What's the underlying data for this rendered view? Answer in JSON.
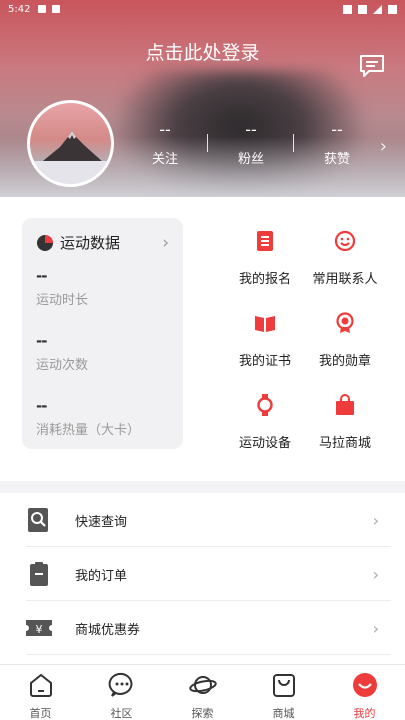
{
  "status_bar": {
    "time": "5:42"
  },
  "header": {
    "login_prompt": "点击此处登录",
    "message_icon": "message-icon",
    "stats": [
      {
        "value": "--",
        "label": "关注"
      },
      {
        "value": "--",
        "label": "粉丝"
      },
      {
        "value": "--",
        "label": "获赞"
      }
    ]
  },
  "sport_card": {
    "title": "运动数据",
    "metrics": [
      {
        "value": "--",
        "label": "运动时长"
      },
      {
        "value": "--",
        "label": "运动次数"
      },
      {
        "value": "--",
        "label": "消耗热量（大卡）"
      }
    ]
  },
  "grid": [
    {
      "label": "我的报名",
      "icon": "registration-icon"
    },
    {
      "label": "常用联系人",
      "icon": "contacts-icon"
    },
    {
      "label": "我的证书",
      "icon": "certificate-icon"
    },
    {
      "label": "我的勋章",
      "icon": "medal-icon"
    },
    {
      "label": "运动设备",
      "icon": "watch-icon"
    },
    {
      "label": "马拉商城",
      "icon": "shop-bag-icon"
    }
  ],
  "list": [
    {
      "label": "快速查询",
      "icon": "quick-search-icon"
    },
    {
      "label": "我的订单",
      "icon": "order-icon"
    },
    {
      "label": "商城优惠券",
      "icon": "coupon-icon"
    }
  ],
  "tabs": [
    {
      "label": "首页",
      "icon": "home-icon"
    },
    {
      "label": "社区",
      "icon": "community-icon"
    },
    {
      "label": "探索",
      "icon": "planet-icon"
    },
    {
      "label": "商城",
      "icon": "shop-icon"
    },
    {
      "label": "我的",
      "icon": "profile-icon",
      "active": true
    }
  ],
  "colors": {
    "accent": "#EE3B3B",
    "card_bg": "#F1F1F3"
  }
}
